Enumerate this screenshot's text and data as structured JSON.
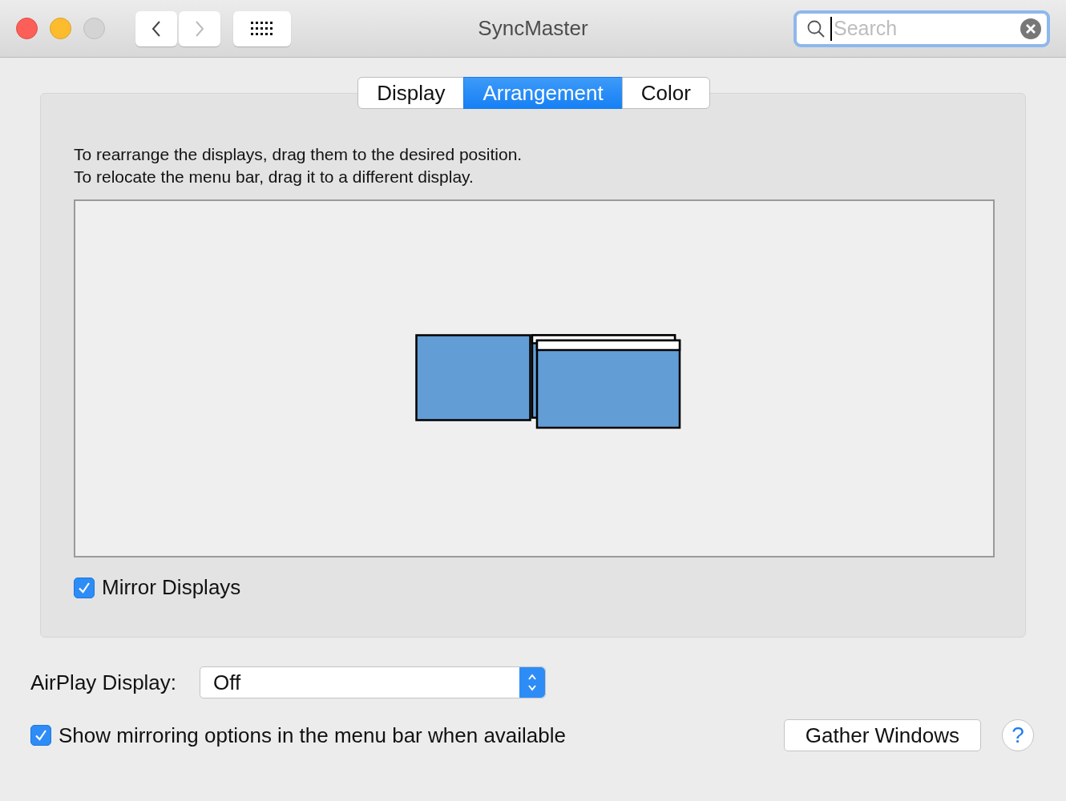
{
  "window": {
    "title": "SyncMaster"
  },
  "search": {
    "placeholder": "Search"
  },
  "tabs": [
    {
      "label": "Display",
      "selected": false
    },
    {
      "label": "Arrangement",
      "selected": true
    },
    {
      "label": "Color",
      "selected": false
    }
  ],
  "instructions": [
    "To rearrange the displays, drag them to the desired position.",
    "To relocate the menu bar, drag it to a different display."
  ],
  "mirror_displays": {
    "label": "Mirror Displays",
    "checked": true
  },
  "airplay": {
    "label": "AirPlay Display:",
    "value": "Off"
  },
  "show_mirroring": {
    "label": "Show mirroring options in the menu bar when available",
    "checked": true
  },
  "gather_button": "Gather Windows",
  "help_button": "?"
}
